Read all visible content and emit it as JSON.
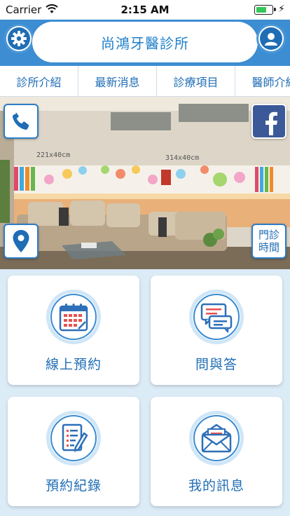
{
  "status_bar": {
    "carrier": "Carrier",
    "time": "2:15 AM",
    "wifi_icon": "wifi-icon",
    "battery_icon": "battery-icon",
    "charging_icon": "charging-bolt-icon"
  },
  "header": {
    "title": "尚鴻牙醫診所",
    "settings_icon": "gear-icon",
    "profile_icon": "user-icon",
    "background_color": "#3c8dd2"
  },
  "tabs": [
    {
      "label": "診所介紹"
    },
    {
      "label": "最新消息"
    },
    {
      "label": "診療項目"
    },
    {
      "label": "醫師介紹"
    }
  ],
  "banner": {
    "wall_sign_left": "221x40cm",
    "wall_sign_right": "314x40cm",
    "phone_icon": "phone-icon",
    "facebook_icon": "facebook-icon",
    "location_icon": "map-pin-icon",
    "hours_label_line1": "門診",
    "hours_label_line2": "時間"
  },
  "cards": [
    {
      "label": "線上預約",
      "icon": "calendar-icon"
    },
    {
      "label": "問與答",
      "icon": "chat-bubbles-icon"
    },
    {
      "label": "預約紀錄",
      "icon": "notepad-pencil-icon"
    },
    {
      "label": "我的訊息",
      "icon": "envelope-icon"
    }
  ],
  "colors": {
    "accent": "#1f6db5",
    "page_background": "#dcecf7",
    "facebook": "#3b5998"
  }
}
